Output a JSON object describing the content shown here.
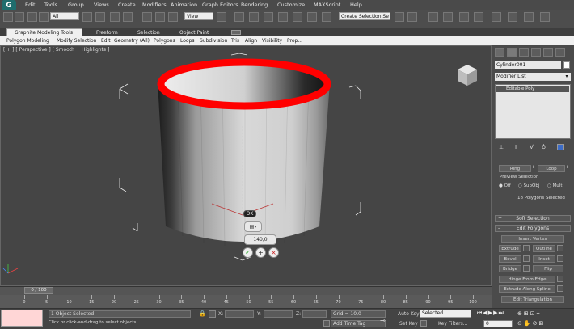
{
  "menu": {
    "items": [
      "Edit",
      "Tools",
      "Group",
      "Views",
      "Create",
      "Modifiers",
      "Animation",
      "Graph Editors",
      "Rendering",
      "Customize",
      "MAXScript",
      "Help"
    ]
  },
  "toolbar": {
    "filter_value": "All",
    "refcoord_value": "View",
    "selection_set_placeholder": "Create Selection Se"
  },
  "ribbon": {
    "tabs": [
      "Graphite Modeling Tools",
      "Freeform",
      "Selection",
      "Object Paint"
    ],
    "subtabs": [
      "Polygon Modeling",
      "Modify Selection",
      "Edit",
      "Geometry (All)",
      "Polygons",
      "Loops",
      "Subdivision",
      "Tris",
      "Align",
      "Visibility",
      "Prop..."
    ]
  },
  "viewport": {
    "label": "[ + ] [ Perspective ] [ Smooth + Highlights ]",
    "caddy_ok": "OK",
    "caddy_value": "140,0"
  },
  "command_panel": {
    "object_name": "Cylinder001",
    "modifier_list": "Modifier List",
    "stack_item": "Editable Poly",
    "ring_label": "Ring",
    "loop_label": "Loop",
    "preview_selection_label": "Preview Selection",
    "preview_options": [
      "Off",
      "SubObj",
      "Multi"
    ],
    "selection_info": "18 Polygons Selected",
    "rollouts": {
      "soft_selection": "Soft Selection",
      "edit_polygons": "Edit Polygons"
    },
    "buttons": {
      "insert_vertex": "Insert Vertex",
      "extrude": "Extrude",
      "outline": "Outline",
      "bevel": "Bevel",
      "inset": "Inset",
      "bridge": "Bridge",
      "flip": "Flip",
      "hinge_from_edge": "Hinge From Edge",
      "extrude_along_spline": "Extrude Along Spline",
      "edit_triangulation": "Edit Triangulation"
    },
    "expand_symbols": {
      "soft_selection": "+",
      "edit_polygons": "-"
    }
  },
  "timeline": {
    "frame_readout": "0 / 100",
    "ticks": [
      "0",
      "5",
      "10",
      "15",
      "20",
      "25",
      "30",
      "35",
      "40",
      "45",
      "50",
      "55",
      "60",
      "65",
      "70",
      "75",
      "80",
      "85",
      "90",
      "95",
      "100"
    ]
  },
  "status": {
    "objects_selected": "1 Object Selected",
    "prompt": "Click or click-and-drag to select objects",
    "x_label": "X:",
    "y_label": "Y:",
    "z_label": "Z:",
    "grid": "Grid = 10,0",
    "add_time_tag": "Add Time Tag",
    "auto_key": "Auto Key",
    "set_key": "Set Key",
    "key_mode": "Selected",
    "key_filters": "Key Filters...",
    "frame_value": "0"
  },
  "colors": {
    "selection_ring": "#ff0000",
    "app_logo": "#1f6d6d"
  }
}
